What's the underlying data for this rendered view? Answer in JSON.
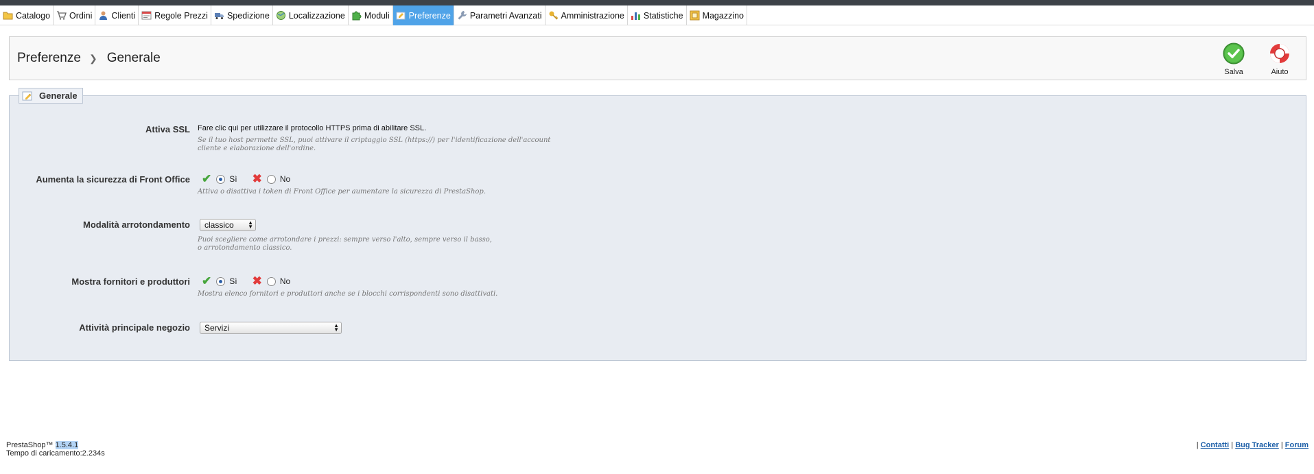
{
  "tabs": [
    {
      "label": "Catalogo",
      "icon": "folder-icon",
      "active": false
    },
    {
      "label": "Ordini",
      "icon": "cart-icon",
      "active": false
    },
    {
      "label": "Clienti",
      "icon": "user-icon",
      "active": false
    },
    {
      "label": "Regole Prezzi",
      "icon": "price-rules-icon",
      "active": false
    },
    {
      "label": "Spedizione",
      "icon": "truck-icon",
      "active": false
    },
    {
      "label": "Localizzazione",
      "icon": "globe-icon",
      "active": false
    },
    {
      "label": "Moduli",
      "icon": "puzzle-icon",
      "active": false
    },
    {
      "label": "Preferenze",
      "icon": "preferences-icon",
      "active": true
    },
    {
      "label": "Parametri Avanzati",
      "icon": "wrench-icon",
      "active": false
    },
    {
      "label": "Amministrazione",
      "icon": "key-icon",
      "active": false
    },
    {
      "label": "Statistiche",
      "icon": "bar-chart-icon",
      "active": false
    },
    {
      "label": "Magazzino",
      "icon": "warehouse-icon",
      "active": false
    }
  ],
  "header": {
    "breadcrumb_parent": "Preferenze",
    "breadcrumb_current": "Generale",
    "save_label": "Salva",
    "help_label": "Aiuto"
  },
  "panel": {
    "legend": "Generale",
    "rows": {
      "ssl": {
        "label": "Attiva SSL",
        "link_text": "Fare clic qui per utilizzare il protocollo HTTPS prima di abilitare SSL.",
        "hint": "Se il tuo host permette SSL, puoi attivare il criptaggio SSL (https://) per l'identificazione dell'account cliente e elaborazione dell'ordine."
      },
      "front_security": {
        "label": "Aumenta la sicurezza di Front Office",
        "yes": "Sì",
        "no": "No",
        "selected": "yes",
        "hint": "Attiva o disattiva i token di Front Office per aumentare la sicurezza di PrestaShop."
      },
      "rounding": {
        "label": "Modalità arrotondamento",
        "value": "classico",
        "hint": "Puoi scegliere come arrotondare i prezzi: sempre verso l'alto, sempre verso il basso, o arrotondamento classico."
      },
      "suppliers": {
        "label": "Mostra fornitori e produttori",
        "yes": "Sì",
        "no": "No",
        "selected": "yes",
        "hint": "Mostra elenco fornitori e produttori anche se i blocchi corrispondenti sono disattivati."
      },
      "activity": {
        "label": "Attività principale negozio",
        "value": "Servizi"
      }
    }
  },
  "footer": {
    "brand": "PrestaShop™",
    "version": "1.5.4.1",
    "load_time": "Tempo di caricamento:2.234s",
    "links": [
      "Contatti",
      "Bug Tracker",
      "Forum"
    ]
  },
  "colors": {
    "active_tab": "#4fa3e8",
    "panel_bg": "#e8ecf2",
    "save_green": "#47a63c",
    "help_red": "#e23b3b"
  }
}
